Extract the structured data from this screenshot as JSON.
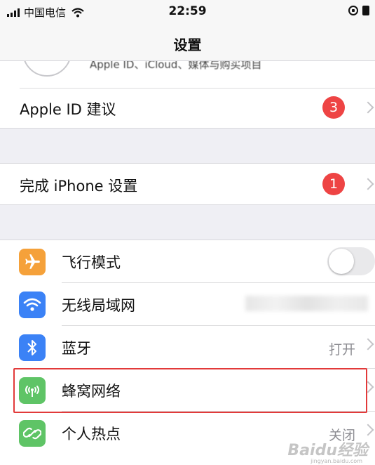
{
  "status_bar": {
    "carrier": "中国电信",
    "time": "22:59"
  },
  "nav": {
    "title": "设置"
  },
  "apple_id": {
    "subtitle": "Apple ID、iCloud、媒体与购买项目"
  },
  "rows": {
    "apple_id_suggestions": {
      "label": "Apple ID 建议",
      "badge": "3"
    },
    "finish_iphone_setup": {
      "label": "完成 iPhone 设置",
      "badge": "1"
    },
    "airplane_mode": {
      "label": "飞行模式",
      "toggle_on": false
    },
    "wifi": {
      "label": "无线局域网"
    },
    "bluetooth": {
      "label": "蓝牙",
      "value": "打开"
    },
    "cellular": {
      "label": "蜂窝网络"
    },
    "hotspot": {
      "label": "个人热点",
      "value": "关闭"
    }
  },
  "watermark": {
    "text": "Baidu经验",
    "sub": "jingyan.baidu.com"
  },
  "colors": {
    "badge": "#ee4444",
    "airplane_icon": "#f5a13a",
    "wifi_icon": "#3b82f6",
    "bluetooth_icon": "#3b82f6",
    "cellular_icon": "#5fc466",
    "hotspot_icon": "#5fc466",
    "highlight": "#e23a3a"
  }
}
